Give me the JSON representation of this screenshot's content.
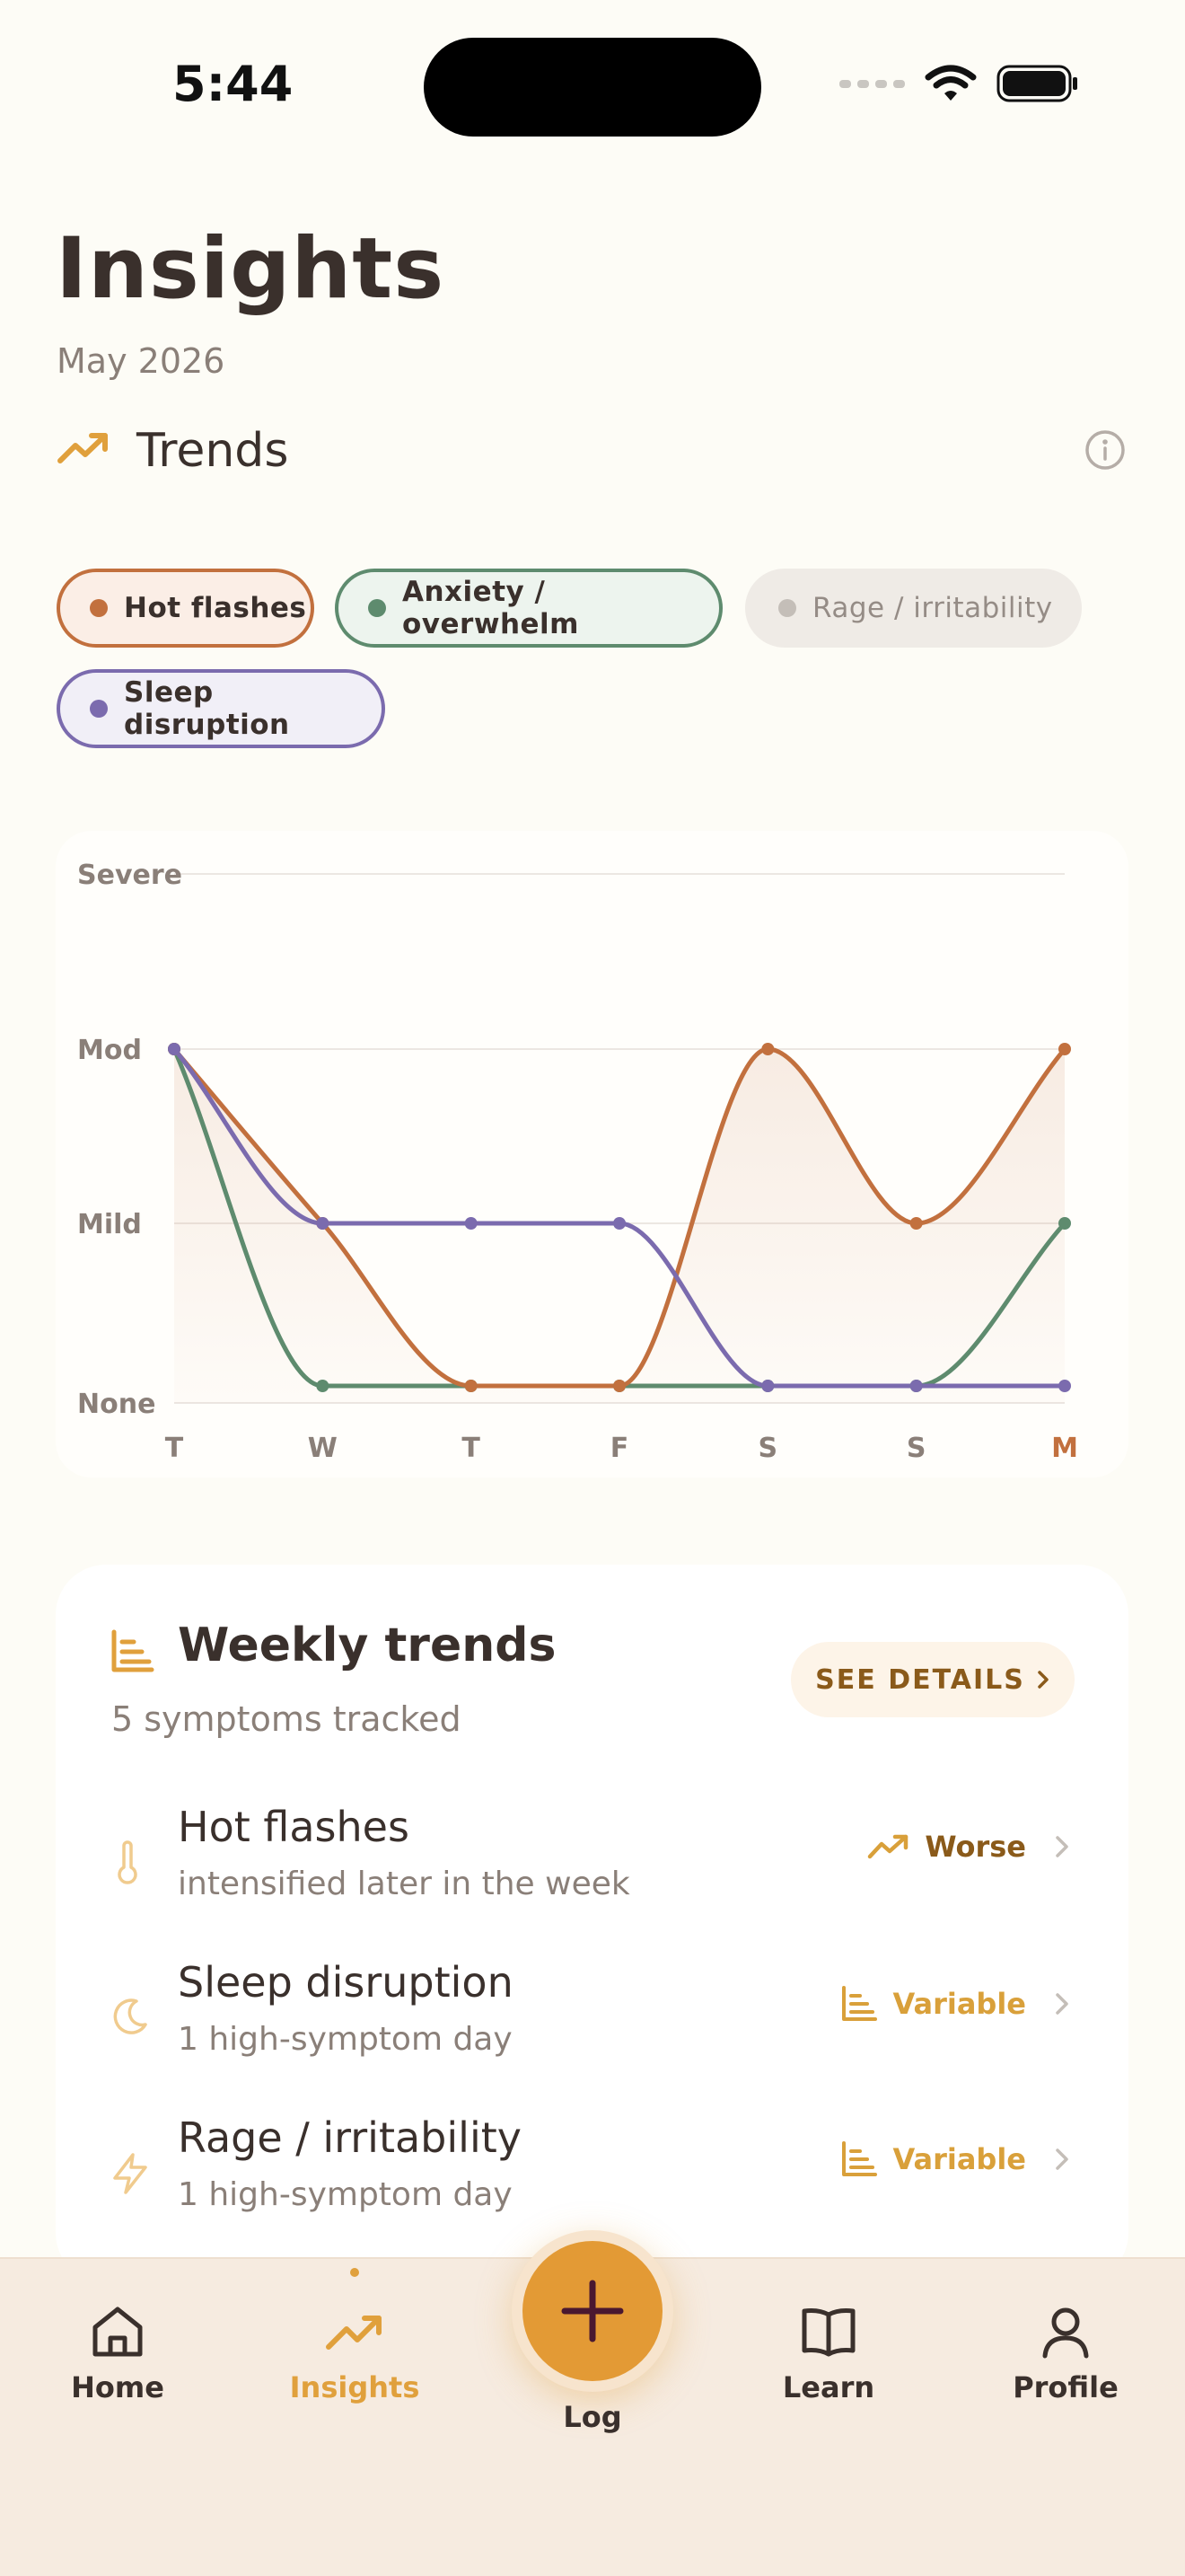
{
  "status_bar": {
    "time": "5:44"
  },
  "header": {
    "title": "Insights",
    "subtitle": "May 2026"
  },
  "trends": {
    "label": "Trends"
  },
  "chips": [
    {
      "label": "Hot flashes",
      "color": "#C2703E",
      "active": true
    },
    {
      "label": "Anxiety / overwhelm",
      "color": "#5E8B6E",
      "active": true
    },
    {
      "label": "Rage / irritability",
      "color": "#C4BEB8",
      "active": false
    },
    {
      "label": "Sleep disruption",
      "color": "#7B6BAE",
      "active": true
    }
  ],
  "chart_data": {
    "type": "line",
    "y_levels": [
      "None",
      "Mild",
      "Mod",
      "Severe"
    ],
    "ylim": [
      0,
      3
    ],
    "categories": [
      "T",
      "W",
      "T",
      "F",
      "S",
      "S",
      "M"
    ],
    "highlight_category_index": 6,
    "grid": true,
    "series": [
      {
        "name": "Hot flashes",
        "color": "#C2703E",
        "values": [
          2,
          1,
          0,
          0,
          2,
          1,
          2
        ],
        "filled": true
      },
      {
        "name": "Anxiety / overwhelm",
        "color": "#5E8B6E",
        "values": [
          2,
          0,
          0,
          0,
          0,
          0,
          1
        ]
      },
      {
        "name": "Sleep disruption",
        "color": "#7B6BAE",
        "values": [
          2,
          1,
          1,
          1,
          0,
          0,
          0
        ]
      }
    ]
  },
  "weekly": {
    "title": "Weekly trends",
    "subtitle": "5 symptoms tracked",
    "see_details_label": "SEE DETAILS",
    "rows": [
      {
        "title": "Hot flashes",
        "subtitle": "intensified later in the week",
        "status": "Worse",
        "icon": "thermometer-icon",
        "status_icon": "trend-up-icon",
        "status_color": "#8A5A1A"
      },
      {
        "title": "Sleep disruption",
        "subtitle": "1 high-symptom day",
        "status": "Variable",
        "icon": "moon-icon",
        "status_icon": "bar-chart-icon",
        "status_color": "#D9A03A"
      },
      {
        "title": "Rage / irritability",
        "subtitle": "1 high-symptom day",
        "status": "Variable",
        "icon": "lightning-icon",
        "status_icon": "bar-chart-icon",
        "status_color": "#D9A03A"
      }
    ]
  },
  "tabbar": {
    "home": "Home",
    "insights": "Insights",
    "log": "Log",
    "learn": "Learn",
    "profile": "Profile",
    "active": "insights",
    "accent_color": "#E0A03C"
  }
}
